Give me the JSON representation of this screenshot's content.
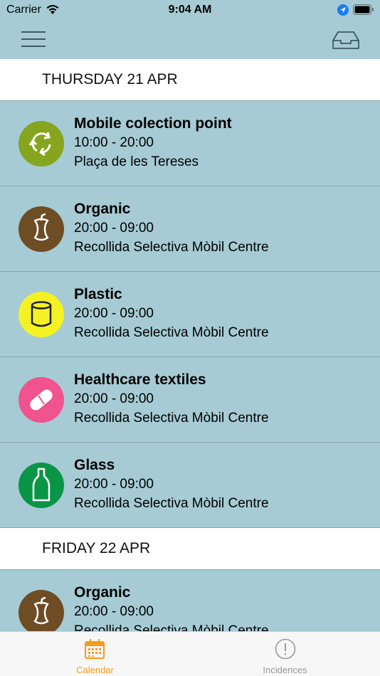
{
  "status": {
    "carrier": "Carrier",
    "time": "9:04 AM"
  },
  "nav": {
    "menu_icon": "hamburger-icon",
    "inbox_icon": "inbox-icon"
  },
  "sections": [
    {
      "header": "THURSDAY 21 APR",
      "events": [
        {
          "title": "Mobile colection point",
          "time": "10:00 - 20:00",
          "place": "Plaça de les Tereses",
          "icon": "recycle-icon",
          "color": "#85a51e"
        },
        {
          "title": "Organic",
          "time": "20:00 - 09:00",
          "place": "Recollida Selectiva Mòbil Centre",
          "icon": "apple-core-icon",
          "color": "#6e4c24"
        },
        {
          "title": "Plastic",
          "time": "20:00 - 09:00",
          "place": "Recollida Selectiva Mòbil Centre",
          "icon": "can-icon",
          "color": "#f4f225"
        },
        {
          "title": "Healthcare textiles",
          "time": "20:00 - 09:00",
          "place": "Recollida Selectiva Mòbil Centre",
          "icon": "bandage-icon",
          "color": "#f0538d"
        },
        {
          "title": "Glass",
          "time": "20:00 - 09:00",
          "place": "Recollida Selectiva Mòbil Centre",
          "icon": "bottle-icon",
          "color": "#0a9446"
        }
      ]
    },
    {
      "header": "FRIDAY 22 APR",
      "events": [
        {
          "title": "Organic",
          "time": "20:00 - 09:00",
          "place": "Recollida Selectiva Mòbil Centre",
          "icon": "apple-core-icon",
          "color": "#6e4c24"
        }
      ]
    }
  ],
  "tabs": [
    {
      "label": "Calendar",
      "icon": "calendar-icon",
      "active": true
    },
    {
      "label": "Incidences",
      "icon": "alert-circle-icon",
      "active": false
    }
  ]
}
